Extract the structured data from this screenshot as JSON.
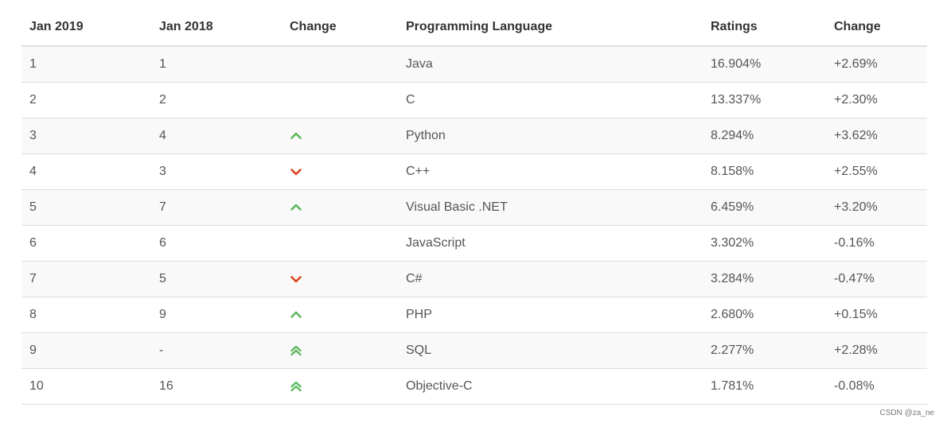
{
  "table": {
    "headers": [
      "Jan 2019",
      "Jan 2018",
      "Change",
      "Programming Language",
      "Ratings",
      "Change"
    ],
    "rows": [
      {
        "jan2019": "1",
        "jan2018": "1",
        "trend": "none",
        "language": "Java",
        "ratings": "16.904%",
        "change": "+2.69%"
      },
      {
        "jan2019": "2",
        "jan2018": "2",
        "trend": "none",
        "language": "C",
        "ratings": "13.337%",
        "change": "+2.30%"
      },
      {
        "jan2019": "3",
        "jan2018": "4",
        "trend": "up",
        "language": "Python",
        "ratings": "8.294%",
        "change": "+3.62%"
      },
      {
        "jan2019": "4",
        "jan2018": "3",
        "trend": "down",
        "language": "C++",
        "ratings": "8.158%",
        "change": "+2.55%"
      },
      {
        "jan2019": "5",
        "jan2018": "7",
        "trend": "up",
        "language": "Visual Basic .NET",
        "ratings": "6.459%",
        "change": "+3.20%"
      },
      {
        "jan2019": "6",
        "jan2018": "6",
        "trend": "none",
        "language": "JavaScript",
        "ratings": "3.302%",
        "change": "-0.16%"
      },
      {
        "jan2019": "7",
        "jan2018": "5",
        "trend": "down",
        "language": "C#",
        "ratings": "3.284%",
        "change": "-0.47%"
      },
      {
        "jan2019": "8",
        "jan2018": "9",
        "trend": "up",
        "language": "PHP",
        "ratings": "2.680%",
        "change": "+0.15%"
      },
      {
        "jan2019": "9",
        "jan2018": "-",
        "trend": "double-up",
        "language": "SQL",
        "ratings": "2.277%",
        "change": "+2.28%"
      },
      {
        "jan2019": "10",
        "jan2018": "16",
        "trend": "double-up",
        "language": "Objective-C",
        "ratings": "1.781%",
        "change": "-0.08%"
      }
    ]
  },
  "icons": {
    "up": "chevron-up-icon",
    "down": "chevron-down-icon",
    "double-up": "double-chevron-up-icon"
  },
  "colors": {
    "up": "#5cb85c",
    "down": "#d9431a"
  },
  "watermark": "CSDN @za_ne"
}
